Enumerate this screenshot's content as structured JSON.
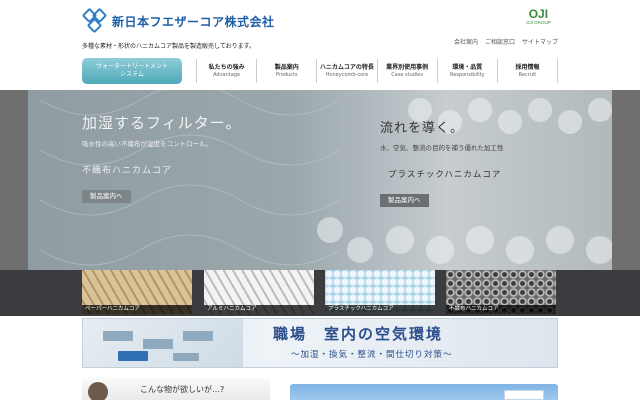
{
  "header": {
    "company_name": "新日本フエザーコア株式会社",
    "tagline": "多種な素材・形状のハニカムコア製品を製造販売しております。",
    "group_logo": "OJI",
    "group_logo_sub": "OJI GROUP",
    "links": [
      "会社案内",
      "ご相談窓口",
      "サイトマップ"
    ]
  },
  "nav": {
    "special": {
      "line1": "ウォータートリートメント",
      "line2": "システム"
    },
    "items": [
      {
        "jp": "私たちの強み",
        "en": "Advantage"
      },
      {
        "jp": "製品案内",
        "en": "Products"
      },
      {
        "jp": "ハニカムコアの特長",
        "en": "Honeycomb-core"
      },
      {
        "jp": "業界別使用事例",
        "en": "Case studies"
      },
      {
        "jp": "環境・品質",
        "en": "Responsibility"
      },
      {
        "jp": "採用情報",
        "en": "Recruit"
      }
    ]
  },
  "hero": {
    "left": {
      "title": "加湿するフィルター。",
      "subtitle": "吸水性の高い不織布が湿度をコントロール。",
      "product": "不織布ハニカムコア",
      "button": "製品案内へ"
    },
    "right": {
      "title": "流れを導く。",
      "subtitle": "水、空気、整流の目的を補う優れた加工性",
      "product": "プラスチックハニカムコア",
      "button": "製品案内へ"
    }
  },
  "thumbnails": [
    {
      "label": "ペーパーハニカムコア"
    },
    {
      "label": "アルミハニカムコア"
    },
    {
      "label": "プラスチックハニカムコア"
    },
    {
      "label": "不織布ハニカムコア"
    }
  ],
  "banner": {
    "title": "職場　室内の空気環境",
    "subtitle": "～加湿・換気・整流・間仕切り対策～"
  },
  "bottom": {
    "left_text": "こんな物が欲しいが…?"
  }
}
